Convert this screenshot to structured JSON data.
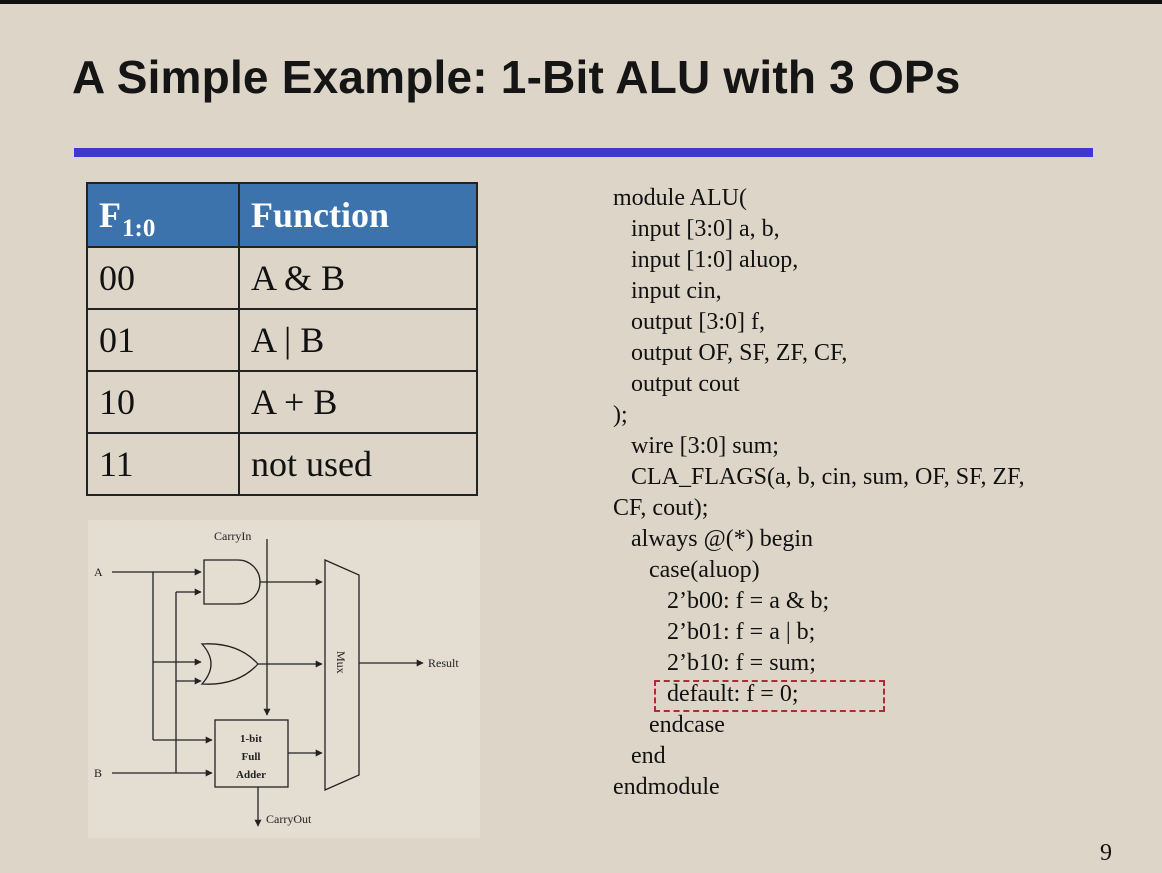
{
  "slide": {
    "title": "A Simple Example: 1-Bit ALU with 3 OPs",
    "page_number": "9"
  },
  "function_table": {
    "header": {
      "f_label": "F",
      "f_subscript": "1:0",
      "function_label": "Function"
    },
    "rows": [
      {
        "code": "00",
        "function": "A & B"
      },
      {
        "code": "01",
        "function": "A | B"
      },
      {
        "code": "10",
        "function": "A + B"
      },
      {
        "code": "11",
        "function": "not used"
      }
    ]
  },
  "diagram": {
    "carry_in_label": "CarryIn",
    "input_a_label": "A",
    "input_b_label": "B",
    "mux_label": "Mux",
    "result_label": "Result",
    "adder_label_line1": "1-bit",
    "adder_label_line2": "Full",
    "adder_label_line3": "Adder",
    "carry_out_label": "CarryOut"
  },
  "code": {
    "lines": [
      "module ALU(",
      "   input [3:0] a, b,",
      "   input [1:0] aluop,",
      "   input cin,",
      "   output [3:0] f,",
      "   output OF, SF, ZF, CF,",
      "   output cout",
      ");",
      "   wire [3:0] sum;",
      "   CLA_FLAGS(a, b, cin, sum, OF, SF, ZF,",
      "CF, cout);",
      "   always @(*) begin",
      "      case(aluop)",
      "         2’b00: f = a & b;",
      "         2’b01: f = a | b;",
      "         2’b10: f = sum;",
      "         default: f = 0;",
      "      endcase",
      "   end",
      "endmodule"
    ],
    "highlighted_line_index": 16,
    "highlight_color": "#b02a35"
  },
  "colors": {
    "background": "#dcd5c8",
    "title_rule": "#3e37d0",
    "table_header": "#3d73ad"
  }
}
